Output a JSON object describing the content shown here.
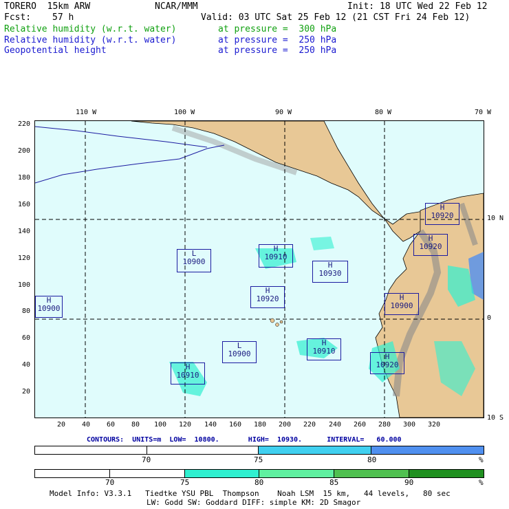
{
  "header": {
    "model": "TORERO  15km ARW",
    "center": "NCAR/MMM",
    "init": "Init: 18 UTC Wed 22 Feb 12",
    "fcst_label": "Fcst:",
    "fcst_value": "57 h",
    "valid": "Valid: 03 UTC Sat 25 Feb 12 (21 CST Fri 24 Feb 12)",
    "fields": [
      {
        "name": "Relative humidity (w.r.t. water)",
        "level": "at pressure =  300 hPa",
        "color": "#10a010"
      },
      {
        "name": "Relative humidity (w.r.t. water)",
        "level": "at pressure =  250 hPa",
        "color": "#1a1ad0"
      },
      {
        "name": "Geopotential height",
        "level": "at pressure =  250 hPa",
        "color": "#1a1ad0"
      }
    ]
  },
  "map": {
    "lon_labels": [
      "110 W",
      "100 W",
      "90 W",
      "80 W",
      "70 W"
    ],
    "lat_labels": [
      "10 N",
      "0",
      "10 S"
    ],
    "y_ticks": [
      "220",
      "200",
      "180",
      "160",
      "140",
      "120",
      "100",
      "80",
      "60",
      "40",
      "20"
    ],
    "x_ticks": [
      "20",
      "40",
      "60",
      "80",
      "100",
      "120",
      "140",
      "160",
      "180",
      "200",
      "220",
      "240",
      "260",
      "280",
      "300",
      "320"
    ],
    "ocean_color": "#e0fcfc",
    "land_color": "#e8c896",
    "centers": [
      {
        "type": "H",
        "value": "10900"
      },
      {
        "type": "L",
        "value": "10900"
      },
      {
        "type": "H",
        "value": "10910"
      },
      {
        "type": "H",
        "value": "10930"
      },
      {
        "type": "H",
        "value": "10920"
      },
      {
        "type": "H",
        "value": "10920"
      },
      {
        "type": "H",
        "value": "10920"
      },
      {
        "type": "H",
        "value": "10900"
      },
      {
        "type": "L",
        "value": "10900"
      },
      {
        "type": "H",
        "value": "10910"
      },
      {
        "type": "H",
        "value": "10910"
      },
      {
        "type": "H",
        "value": "10920"
      }
    ]
  },
  "contours": "CONTOURS:  UNITS=m  LOW=  10800.       HIGH=  10930.      INTERVAL=   60.000",
  "legend_250": {
    "labels": [
      "70",
      "75",
      "80"
    ],
    "unit": "%",
    "colors": [
      "#ffffff",
      "#ffffff",
      "#40d0f0",
      "#5090f0"
    ]
  },
  "legend_300": {
    "labels": [
      "70",
      "75",
      "80",
      "85",
      "90"
    ],
    "unit": "%",
    "colors": [
      "#ffffff",
      "#ffffff",
      "#30f0d0",
      "#60f0a0",
      "#50c050",
      "#209020"
    ]
  },
  "footer": {
    "line1": "Model Info: V3.3.1   Tiedtke YSU PBL  Thompson    Noah LSM  15 km,   44 levels,   80 sec",
    "line2": "LW: Godd SW: Goddard DIFF: simple KM: 2D Smagor"
  }
}
